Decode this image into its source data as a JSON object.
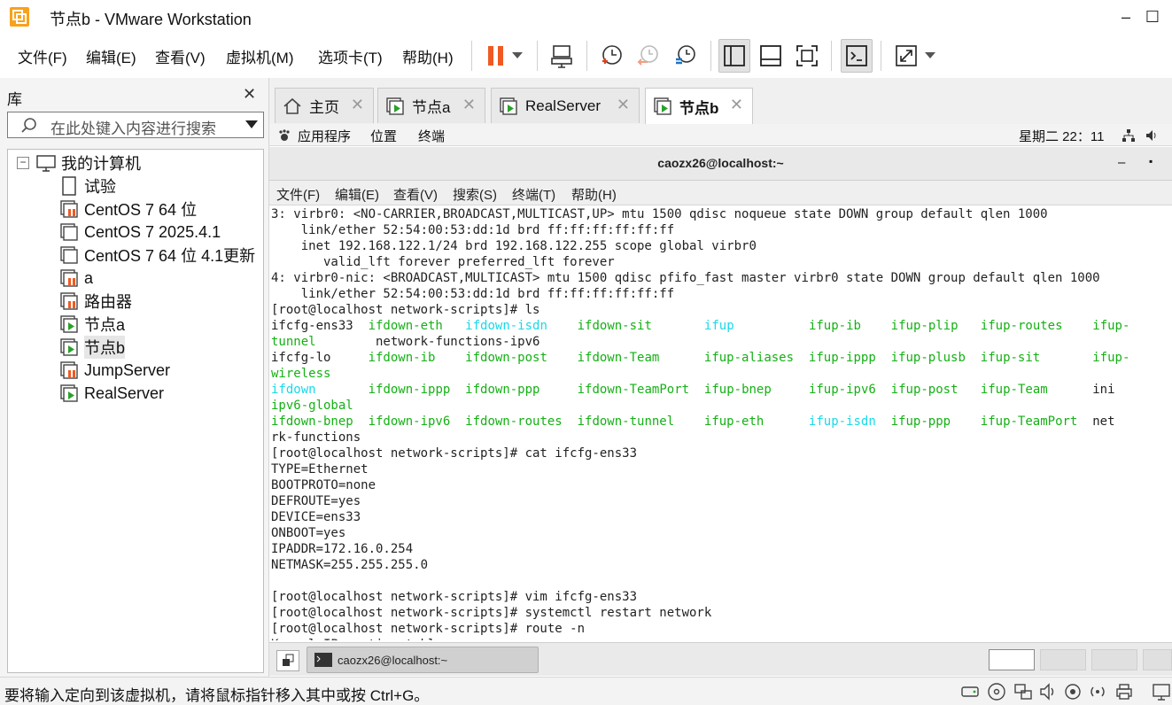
{
  "window": {
    "title": "节点b - VMware Workstation",
    "minimize_glyph": "–",
    "maximize_glyph": "☐"
  },
  "menu": [
    "文件(F)",
    "编辑(E)",
    "查看(V)",
    "虚拟机(M)",
    "选项卡(T)",
    "帮助(H)"
  ],
  "toolbar": {
    "icons": [
      "pause-icon",
      "dropdown-arrow-icon",
      "send-ctrl-alt-del-icon",
      "take-snapshot-icon",
      "revert-snapshot-icon",
      "snapshot-manager-icon",
      "show-library-icon",
      "show-thumbnail-bar-icon",
      "fit-guest-icon",
      "console-view-icon",
      "full-screen-icon",
      "dropdown-arrow-icon"
    ]
  },
  "library": {
    "title": "库",
    "close_glyph": "✕",
    "search_placeholder": "在此处键入内容进行搜索",
    "root": "我的计算机",
    "collapse_glyph": "−",
    "items": [
      {
        "label": "试验",
        "icon": "document-icon"
      },
      {
        "label": "CentOS 7 64 位",
        "icon": "vm-stopped-icon"
      },
      {
        "label": "CentOS 7 2025.4.1",
        "icon": "vm-icon"
      },
      {
        "label": "CentOS 7 64 位 4.1更新",
        "icon": "vm-icon"
      },
      {
        "label": "a",
        "icon": "vm-stopped-icon"
      },
      {
        "label": "路由器",
        "icon": "vm-stopped-icon"
      },
      {
        "label": "节点a",
        "icon": "vm-running-icon"
      },
      {
        "label": "节点b",
        "icon": "vm-running-icon",
        "selected": true
      },
      {
        "label": "JumpServer",
        "icon": "vm-stopped-icon"
      },
      {
        "label": "RealServer",
        "icon": "vm-running-icon"
      }
    ]
  },
  "tabs": [
    {
      "label": "主页",
      "icon": "home-icon",
      "active": false
    },
    {
      "label": "节点a",
      "icon": "vm-running-icon",
      "active": false
    },
    {
      "label": "RealServer",
      "icon": "vm-running-icon",
      "active": false
    },
    {
      "label": "节点b",
      "icon": "vm-running-icon",
      "active": true
    }
  ],
  "tab_close_glyph": "✕",
  "guest": {
    "topbar": {
      "apps": "应用程序",
      "places": "位置",
      "terminal": "终端",
      "clock": "星期二 22：11"
    },
    "terminal_title": "caozx26@localhost:~",
    "terminal_title_btns": [
      "–",
      "▪"
    ],
    "terminal_menu": [
      "文件(F)",
      "编辑(E)",
      "查看(V)",
      "搜索(S)",
      "终端(T)",
      "帮助(H)"
    ],
    "terminal_lines": [
      [
        {
          "t": "3: virbr0: <NO-CARRIER,BROADCAST,MULTICAST,UP> mtu 1500 qdisc noqueue state DOWN group default qlen 1000"
        }
      ],
      [
        {
          "t": "    link/ether 52:54:00:53:dd:1d brd ff:ff:ff:ff:ff:ff"
        }
      ],
      [
        {
          "t": "    inet 192.168.122.1/24 brd 192.168.122.255 scope global virbr0"
        }
      ],
      [
        {
          "t": "       valid_lft forever preferred_lft forever"
        }
      ],
      [
        {
          "t": "4: virbr0-nic: <BROADCAST,MULTICAST> mtu 1500 qdisc pfifo_fast master virbr0 state DOWN group default qlen 1000"
        }
      ],
      [
        {
          "t": "    link/ether 52:54:00:53:dd:1d brd ff:ff:ff:ff:ff:ff"
        }
      ],
      [
        {
          "t": "[root@localhost network-scripts]# ls"
        }
      ],
      [
        {
          "t": "ifcfg-ens33  "
        },
        {
          "t": "ifdown-eth",
          "c": "g"
        },
        {
          "t": "   "
        },
        {
          "t": "ifdown-isdn",
          "c": "c"
        },
        {
          "t": "    "
        },
        {
          "t": "ifdown-sit",
          "c": "g"
        },
        {
          "t": "       "
        },
        {
          "t": "ifup",
          "c": "c"
        },
        {
          "t": "          "
        },
        {
          "t": "ifup-ib",
          "c": "g"
        },
        {
          "t": "    "
        },
        {
          "t": "ifup-plip",
          "c": "g"
        },
        {
          "t": "   "
        },
        {
          "t": "ifup-routes",
          "c": "g"
        },
        {
          "t": "    "
        },
        {
          "t": "ifup-",
          "c": "g"
        }
      ],
      [
        {
          "t": "tunnel",
          "c": "g"
        },
        {
          "t": "        network-functions-ipv6"
        }
      ],
      [
        {
          "t": "ifcfg-lo     "
        },
        {
          "t": "ifdown-ib",
          "c": "g"
        },
        {
          "t": "    "
        },
        {
          "t": "ifdown-post",
          "c": "g"
        },
        {
          "t": "    "
        },
        {
          "t": "ifdown-Team",
          "c": "g"
        },
        {
          "t": "      "
        },
        {
          "t": "ifup-aliases",
          "c": "g"
        },
        {
          "t": "  "
        },
        {
          "t": "ifup-ippp",
          "c": "g"
        },
        {
          "t": "  "
        },
        {
          "t": "ifup-plusb",
          "c": "g"
        },
        {
          "t": "  "
        },
        {
          "t": "ifup-sit",
          "c": "g"
        },
        {
          "t": "       "
        },
        {
          "t": "ifup-",
          "c": "g"
        }
      ],
      [
        {
          "t": "wireless",
          "c": "g"
        }
      ],
      [
        {
          "t": "ifdown",
          "c": "c"
        },
        {
          "t": "       "
        },
        {
          "t": "ifdown-ippp",
          "c": "g"
        },
        {
          "t": "  "
        },
        {
          "t": "ifdown-ppp",
          "c": "g"
        },
        {
          "t": "     "
        },
        {
          "t": "ifdown-TeamPort",
          "c": "g"
        },
        {
          "t": "  "
        },
        {
          "t": "ifup-bnep",
          "c": "g"
        },
        {
          "t": "     "
        },
        {
          "t": "ifup-ipv6",
          "c": "g"
        },
        {
          "t": "  "
        },
        {
          "t": "ifup-post",
          "c": "g"
        },
        {
          "t": "   "
        },
        {
          "t": "ifup-Team",
          "c": "g"
        },
        {
          "t": "      ini"
        }
      ],
      [
        {
          "t": "ipv6-global",
          "c": "g"
        }
      ],
      [
        {
          "t": "ifdown-bnep",
          "c": "g"
        },
        {
          "t": "  "
        },
        {
          "t": "ifdown-ipv6",
          "c": "g"
        },
        {
          "t": "  "
        },
        {
          "t": "ifdown-routes",
          "c": "g"
        },
        {
          "t": "  "
        },
        {
          "t": "ifdown-tunnel",
          "c": "g"
        },
        {
          "t": "    "
        },
        {
          "t": "ifup-eth",
          "c": "g"
        },
        {
          "t": "      "
        },
        {
          "t": "ifup-isdn",
          "c": "c"
        },
        {
          "t": "  "
        },
        {
          "t": "ifup-ppp",
          "c": "g"
        },
        {
          "t": "    "
        },
        {
          "t": "ifup-TeamPort",
          "c": "g"
        },
        {
          "t": "  net"
        }
      ],
      [
        {
          "t": "rk-functions"
        }
      ],
      [
        {
          "t": "[root@localhost network-scripts]# cat ifcfg-ens33"
        }
      ],
      [
        {
          "t": "TYPE=Ethernet"
        }
      ],
      [
        {
          "t": "BOOTPROTO=none"
        }
      ],
      [
        {
          "t": "DEFROUTE=yes"
        }
      ],
      [
        {
          "t": "DEVICE=ens33"
        }
      ],
      [
        {
          "t": "ONBOOT=yes"
        }
      ],
      [
        {
          "t": "IPADDR=172.16.0.254"
        }
      ],
      [
        {
          "t": "NETMASK=255.255.255.0"
        }
      ],
      [
        {
          "t": ""
        }
      ],
      [
        {
          "t": "[root@localhost network-scripts]# vim ifcfg-ens33"
        }
      ],
      [
        {
          "t": "[root@localhost network-scripts]# systemctl restart network"
        }
      ],
      [
        {
          "t": "[root@localhost network-scripts]# route -n"
        }
      ],
      [
        {
          "t": "Kernel IP routing table"
        }
      ]
    ],
    "taskbar_item": "caozx26@localhost:~"
  },
  "status": {
    "message": "要将输入定向到该虚拟机，请将鼠标指针移入其中或按 Ctrl+G。",
    "icons": [
      "hard-disk-icon",
      "cd-dvd-icon",
      "network-adapter-icon",
      "sound-card-icon",
      "usb-icon",
      "wireless-icon",
      "printer-icon",
      "display-icon"
    ]
  }
}
